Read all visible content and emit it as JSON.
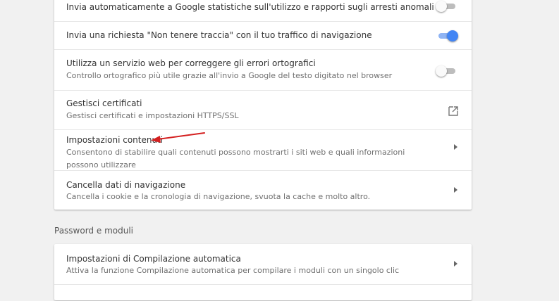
{
  "privacy": {
    "rows": [
      {
        "title": "Invia automaticamente a Google statistiche sull'utilizzo e rapporti sugli arresti anomali",
        "toggle": "off"
      },
      {
        "title": "Invia una richiesta \"Non tenere traccia\" con il tuo traffico di navigazione",
        "toggle": "on"
      },
      {
        "title": "Utilizza un servizio web per correggere gli errori ortografici",
        "subtitle": "Controllo ortografico più utile grazie all'invio a Google del testo digitato nel browser",
        "toggle": "off"
      },
      {
        "title": "Gestisci certificati",
        "subtitle": "Gestisci certificati e impostazioni HTTPS/SSL",
        "icon": "open-in-new-icon"
      },
      {
        "title": "Impostazioni contenuti",
        "subtitle": "Consentono di stabilire quali contenuti possono mostrarti i siti web e quali informazioni possono utilizzare",
        "icon": "chevron-right-icon"
      },
      {
        "title": "Cancella dati di navigazione",
        "subtitle": "Cancella i cookie e la cronologia di navigazione, svuota la cache e molto altro.",
        "icon": "chevron-right-icon"
      }
    ]
  },
  "passwords": {
    "section_title": "Password e moduli",
    "rows": [
      {
        "title": "Impostazioni di Compilazione automatica",
        "subtitle": "Attiva la funzione Compilazione automatica per compilare i moduli con un singolo clic",
        "icon": "chevron-right-icon"
      }
    ]
  },
  "annotation": {
    "icon": "red-arrow-icon",
    "color": "#d42020"
  },
  "colors": {
    "accent": "#4285f4",
    "background": "#f1f1f1"
  }
}
